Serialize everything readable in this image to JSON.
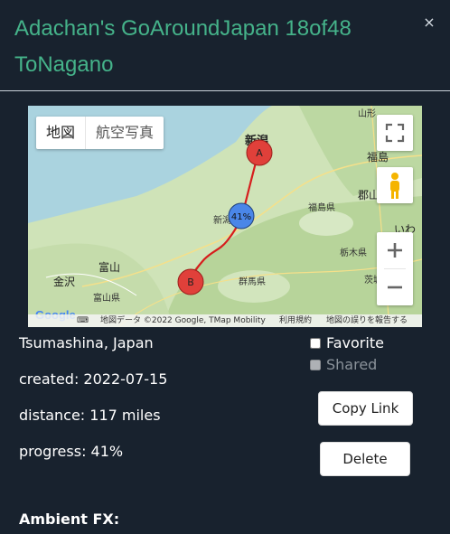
{
  "dialog": {
    "title": "Adachan's GoAroundJapan 18of48 ToNagano",
    "close_label": "×"
  },
  "map": {
    "type_buttons": {
      "map": "地図",
      "satellite": "航空写真"
    },
    "labels": {
      "niigata_top": "新潟",
      "niigata_mid": "新潟",
      "fukushima_city": "福島",
      "fukushima_pref": "福島県",
      "koriyama": "郡山",
      "iwaki": "いわき",
      "tochigi": "栃木県",
      "gunma": "群馬県",
      "ibaraki": "茨城",
      "toyama_city": "富山",
      "toyama_pref": "富山県",
      "kanazawa": "金沢",
      "yamagata": "山形"
    },
    "markers": {
      "start": "A",
      "end": "B",
      "progress": "41%"
    },
    "footer": {
      "data": "地図データ ©2022 Google, TMap Mobility",
      "terms": "利用規約",
      "report": "地図の誤りを報告する"
    },
    "google": "Google",
    "colors": {
      "route": "#d61d1d",
      "marker": "#e0403a",
      "progress": "#4a86e8"
    }
  },
  "details": {
    "location": "Tsumashina, Japan",
    "created": "created: 2022-07-15",
    "distance": "distance: 117 miles",
    "progress": "progress: 41%"
  },
  "options": {
    "favorite": "Favorite",
    "shared": "Shared"
  },
  "buttons": {
    "copy_link": "Copy Link",
    "delete": "Delete"
  },
  "section": {
    "ambient": "Ambient FX:"
  }
}
